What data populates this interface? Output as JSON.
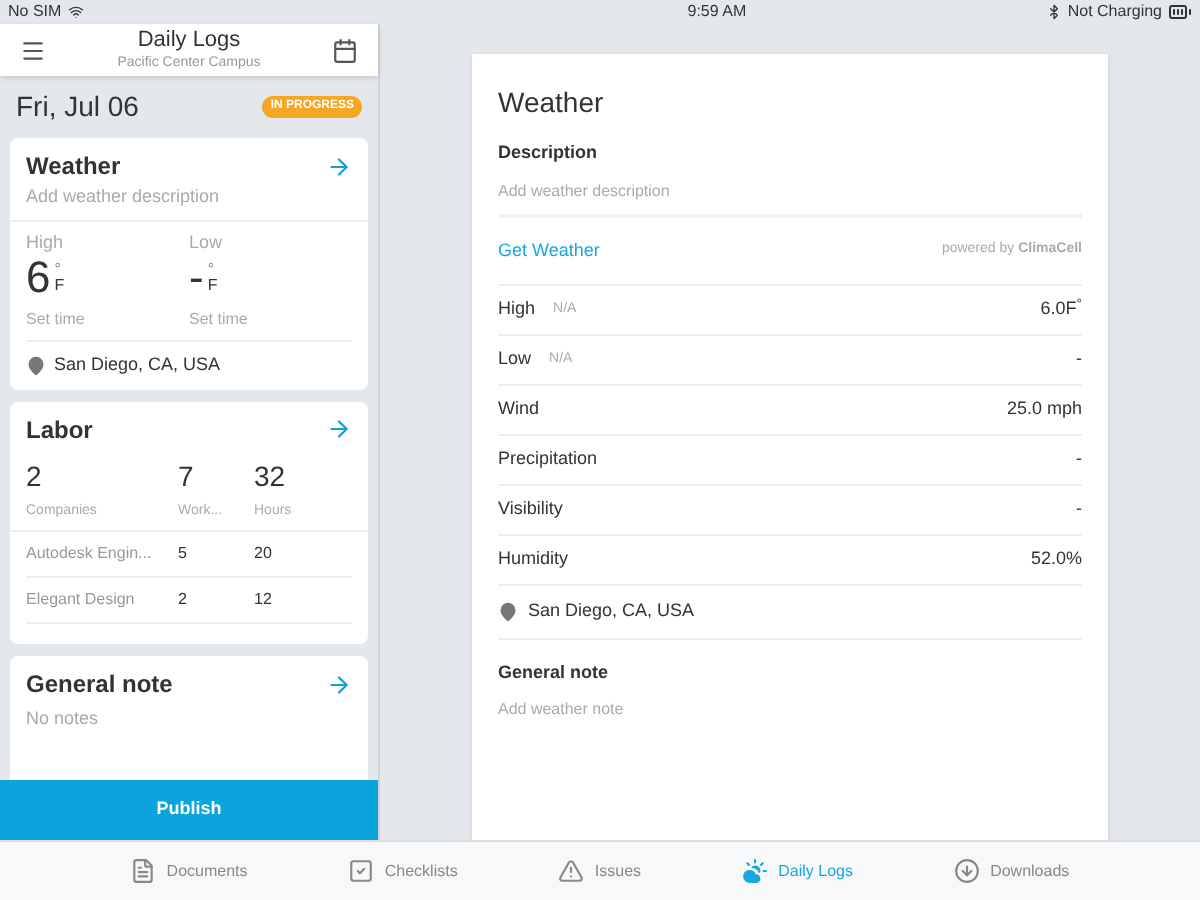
{
  "status_bar": {
    "carrier": "No SIM",
    "time": "9:59 AM",
    "battery_text": "Not Charging"
  },
  "header": {
    "title": "Daily Logs",
    "subtitle": "Pacific Center Campus"
  },
  "date": "Fri, Jul 06",
  "status_badge": "IN PROGRESS",
  "weather_card": {
    "title": "Weather",
    "description_placeholder": "Add weather description",
    "temps": [
      {
        "label": "High",
        "value": "6",
        "degree": "°",
        "unit": "F",
        "time": "Set time"
      },
      {
        "label": "Low",
        "value": "-",
        "degree": "°",
        "unit": "F",
        "time": "Set time"
      }
    ],
    "location": "San Diego, CA, USA"
  },
  "labor_card": {
    "title": "Labor",
    "totals": [
      {
        "value": "2",
        "label": "Companies"
      },
      {
        "value": "7",
        "label": "Work..."
      },
      {
        "value": "32",
        "label": "Hours"
      }
    ],
    "rows": [
      {
        "company": "Autodesk Engin...",
        "workers": "5",
        "hours": "20"
      },
      {
        "company": "Elegant Design",
        "workers": "2",
        "hours": "12"
      }
    ]
  },
  "note_card": {
    "title": "General note",
    "text": "No notes"
  },
  "publish_button": "Publish",
  "detail": {
    "title": "Weather",
    "description_label": "Description",
    "description_placeholder": "Add weather description",
    "get_weather": "Get Weather",
    "powered_by": "powered by **ClimaCell**",
    "rows": [
      {
        "label": "High",
        "note": "N/A",
        "value": "6.0F$^{°}$"
      },
      {
        "label": "Low",
        "note": "N/A",
        "value": "-"
      },
      {
        "label": "Wind",
        "value": "25.0 mph"
      },
      {
        "label": "Precipitation",
        "value": "-"
      },
      {
        "label": "Visibility",
        "value": "-"
      },
      {
        "label": "Humidity",
        "value": "52.0%"
      }
    ],
    "location": "San Diego, CA, USA",
    "note_label": "General note",
    "note_placeholder": "Add weather note"
  },
  "tabs": [
    {
      "label": "Documents",
      "kind": "document",
      "selected": false
    },
    {
      "label": "Checklists",
      "kind": "checklist",
      "selected": false
    },
    {
      "label": "Issues",
      "kind": "warning",
      "selected": false
    },
    {
      "label": "Daily Logs",
      "kind": "cloud",
      "selected": true
    },
    {
      "label": "Downloads",
      "kind": "download",
      "selected": false
    }
  ]
}
